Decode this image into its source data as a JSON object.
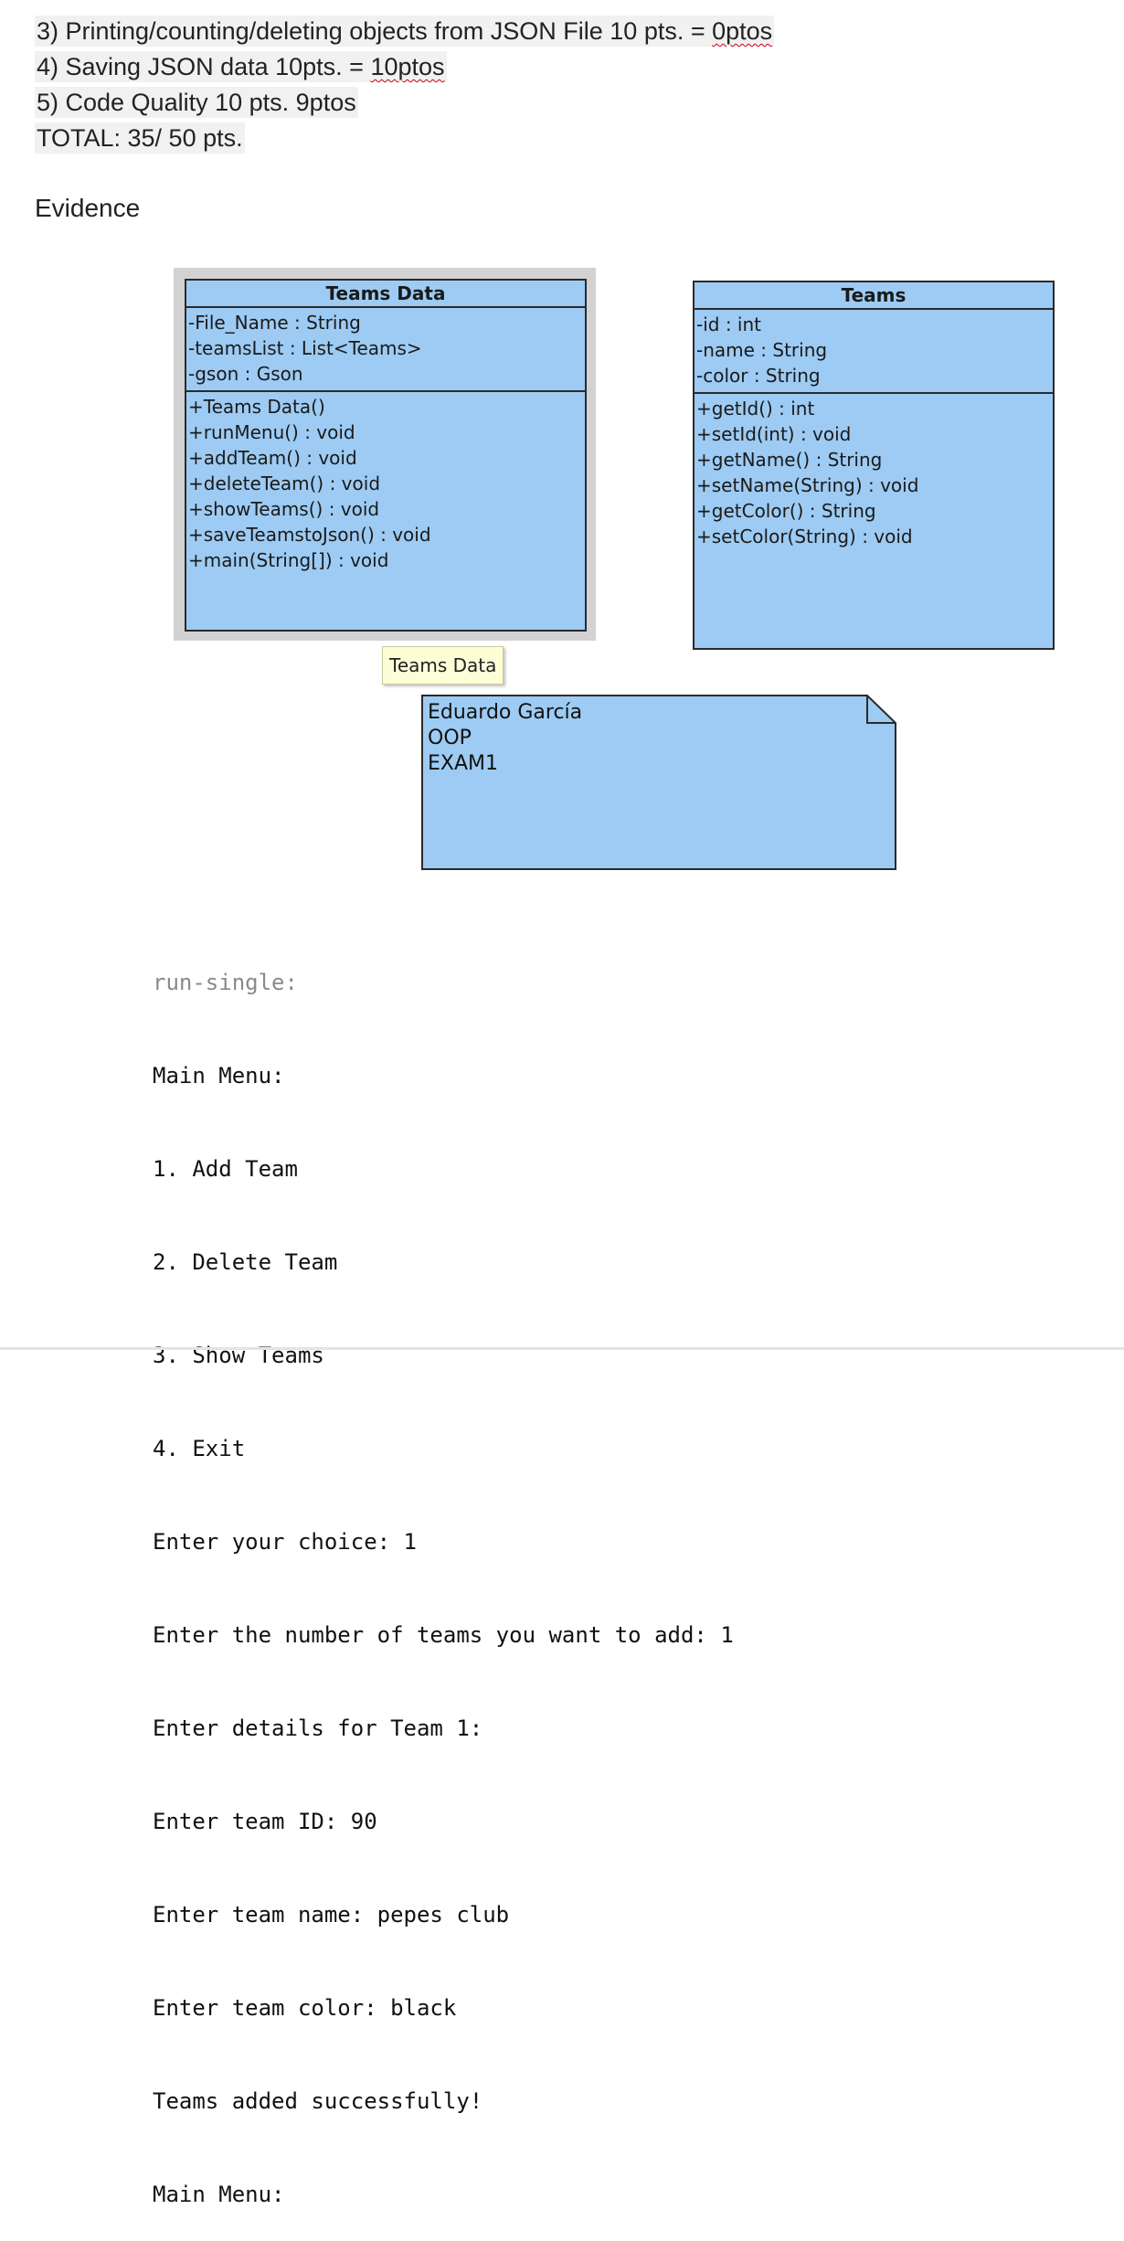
{
  "grading": [
    {
      "text": "3) Printing/counting/deleting objects from JSON File 10 pts. = ",
      "score": "0ptos",
      "flagged": true
    },
    {
      "text": "4) Saving JSON data 10pts. = ",
      "score": "10ptos",
      "flagged": true
    },
    {
      "text": "5) Code Quality 10 pts. ",
      "score": "9ptos",
      "flagged": false
    },
    {
      "text": "TOTAL: 35/ 50 pts.",
      "score": "",
      "flagged": false
    }
  ],
  "evidence_heading": "Evidence",
  "diagram": {
    "teams_data_class": {
      "name": "Teams Data",
      "attributes": [
        "-File_Name : String",
        "-teamsList : List<Teams>",
        "-gson : Gson"
      ],
      "operations": [
        "+Teams Data()",
        "+runMenu() : void",
        "+addTeam() : void",
        "+deleteTeam() : void",
        "+showTeams() : void",
        "+saveTeamstoJson() : void",
        "+main(String[]) : void"
      ]
    },
    "teams_class": {
      "name": "Teams",
      "attributes": [
        "-id : int",
        "-name : String",
        "-color : String"
      ],
      "operations": [
        "+getId() : int",
        "+setId(int) : void",
        "+getName() : String",
        "+setName(String) : void",
        "+getColor() : String",
        "+setColor(String) : void"
      ]
    },
    "tooltip": "Teams Data",
    "note_lines": [
      "Eduardo García",
      "OOP",
      "EXAM1"
    ],
    "colors": {
      "class_fill": "#9dcbf3",
      "border": "#2a2a2a",
      "selection_frame": "#d2d2d2",
      "tooltip_fill": "#fefed6"
    }
  },
  "console": {
    "header": "run-single:",
    "lines": [
      "Main Menu:",
      "1. Add Team",
      "2. Delete Team",
      "3. Show Teams",
      "4. Exit",
      "Enter your choice: 1",
      "Enter the number of teams you want to add: 1",
      "Enter details for Team 1:",
      "Enter team ID: 90",
      "Enter team name: pepes club",
      "Enter team color: black",
      "Teams added successfully!",
      "Main Menu:"
    ]
  }
}
